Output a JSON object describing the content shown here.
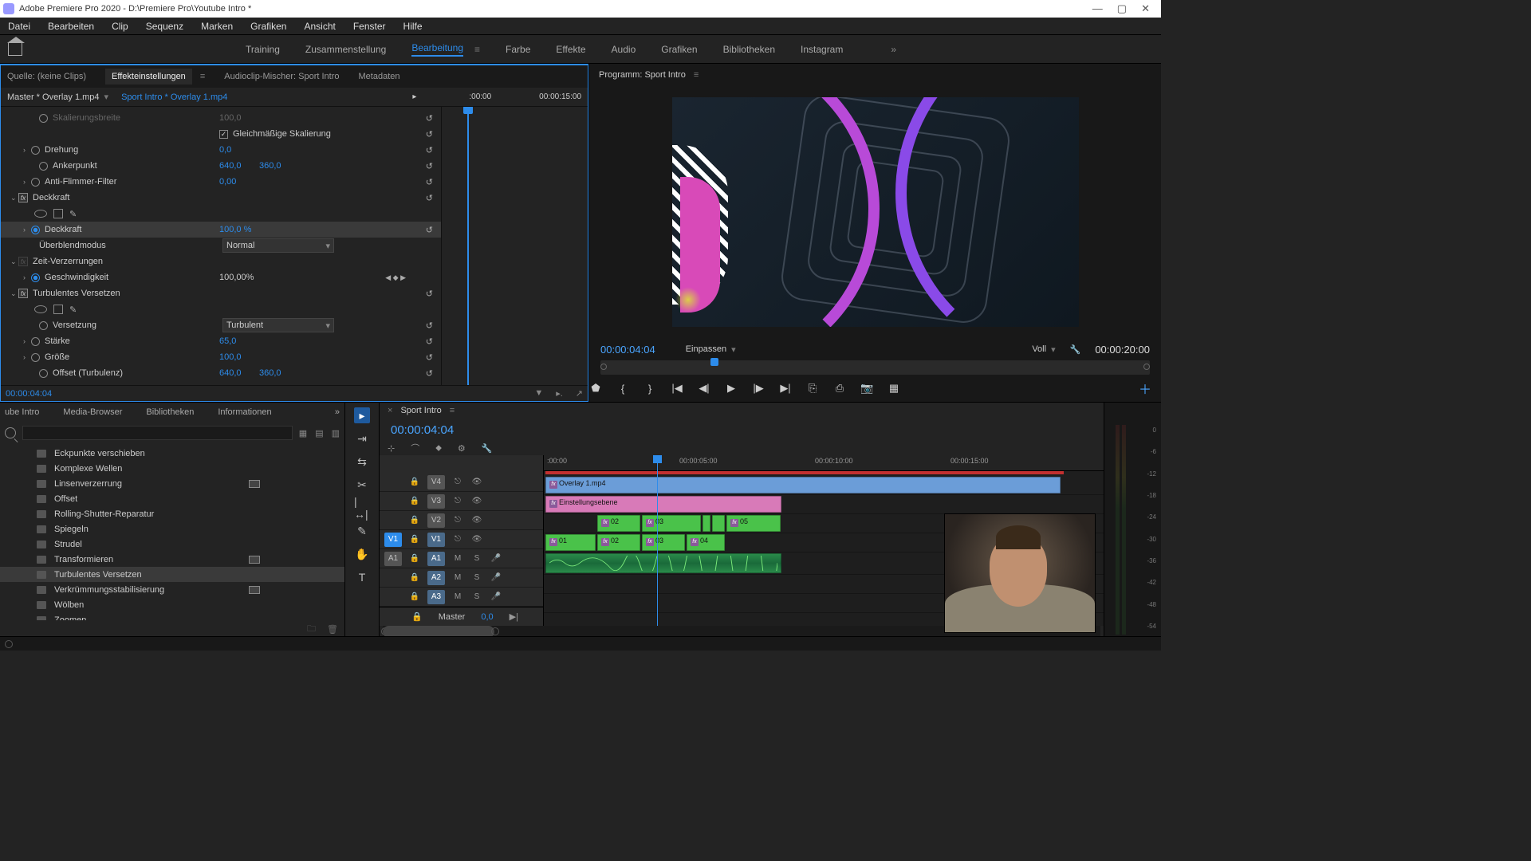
{
  "titlebar": {
    "title": "Adobe Premiere Pro 2020 - D:\\Premiere Pro\\Youtube Intro *"
  },
  "menu": {
    "items": [
      "Datei",
      "Bearbeiten",
      "Clip",
      "Sequenz",
      "Marken",
      "Grafiken",
      "Ansicht",
      "Fenster",
      "Hilfe"
    ]
  },
  "workspaces": {
    "items": [
      "Training",
      "Zusammenstellung",
      "Bearbeitung",
      "Farbe",
      "Effekte",
      "Audio",
      "Grafiken",
      "Bibliotheken",
      "Instagram"
    ],
    "active": "Bearbeitung"
  },
  "source_tabs": {
    "t0": "Quelle: (keine Clips)",
    "t1": "Effekteinstellungen",
    "t2": "Audioclip-Mischer: Sport Intro",
    "t3": "Metadaten"
  },
  "clip_path": {
    "master": "Master * Overlay 1.mp4",
    "seq": "Sport Intro * Overlay 1.mp4",
    "start": ":00:00",
    "end": "00:00:15:00"
  },
  "effects": {
    "skalierungsbreite": {
      "label": "Skalierungsbreite",
      "value": "100,0"
    },
    "uniform": {
      "label": "Gleichmäßige Skalierung"
    },
    "drehung": {
      "label": "Drehung",
      "value": "0,0"
    },
    "anker": {
      "label": "Ankerpunkt",
      "v1": "640,0",
      "v2": "360,0"
    },
    "antiflicker": {
      "label": "Anti-Flimmer-Filter",
      "value": "0,00"
    },
    "deckkraft_group": {
      "label": "Deckkraft"
    },
    "deckkraft": {
      "label": "Deckkraft",
      "value": "100,0 %"
    },
    "blend": {
      "label": "Überblendmodus",
      "value": "Normal"
    },
    "timeremap": {
      "label": "Zeit-Verzerrungen"
    },
    "speed": {
      "label": "Geschwindigkeit",
      "value": "100,00%"
    },
    "turb_group": {
      "label": "Turbulentes Versetzen"
    },
    "versetzung": {
      "label": "Versetzung",
      "value": "Turbulent"
    },
    "staerke": {
      "label": "Stärke",
      "value": "65,0"
    },
    "groesse": {
      "label": "Größe",
      "value": "100,0"
    },
    "offset": {
      "label": "Offset (Turbulenz)",
      "v1": "640,0",
      "v2": "360,0"
    }
  },
  "effect_footer_tc": "00:00:04:04",
  "program": {
    "title": "Programm: Sport Intro",
    "tc": "00:00:04:04",
    "fit": "Einpassen",
    "quality": "Voll",
    "duration": "00:00:20:00"
  },
  "project_tabs": {
    "t0": "ube Intro",
    "t1": "Media-Browser",
    "t2": "Bibliotheken",
    "t3": "Informationen"
  },
  "fx_list": {
    "i0": "Eckpunkte verschieben",
    "i1": "Komplexe Wellen",
    "i2": "Linsenverzerrung",
    "i3": "Offset",
    "i4": "Rolling-Shutter-Reparatur",
    "i5": "Spiegeln",
    "i6": "Strudel",
    "i7": "Transformieren",
    "i8": "Turbulentes Versetzen",
    "i9": "Verkrümmungsstabilisierung",
    "i10": "Wölben",
    "i11": "Zoomen"
  },
  "timeline": {
    "seq": "Sport Intro",
    "tc": "00:00:04:04",
    "ruler": {
      "r0": ":00:00",
      "r1": "00:00:05:00",
      "r2": "00:00:10:00",
      "r3": "00:00:15:00"
    },
    "tracks": {
      "v4": "V4",
      "v3": "V3",
      "v2": "V2",
      "v1s": "V1",
      "v1": "V1",
      "a1s": "A1",
      "a1": "A1",
      "a2": "A2",
      "a3": "A3",
      "master": "Master",
      "master_val": "0,0",
      "mute": "M",
      "solo": "S"
    },
    "clips": {
      "overlay": "Overlay 1.mp4",
      "adjust": "Einstellungsebene",
      "c01": "01",
      "c02": "02",
      "c03": "03",
      "c04": "04",
      "c05": "05"
    }
  },
  "meters": {
    "s0": "0",
    "s6": "-6",
    "s12": "-12",
    "s18": "-18",
    "s24": "-24",
    "s30": "-30",
    "s36": "-36",
    "s42": "-42",
    "s48": "-48",
    "s54": "-54"
  }
}
